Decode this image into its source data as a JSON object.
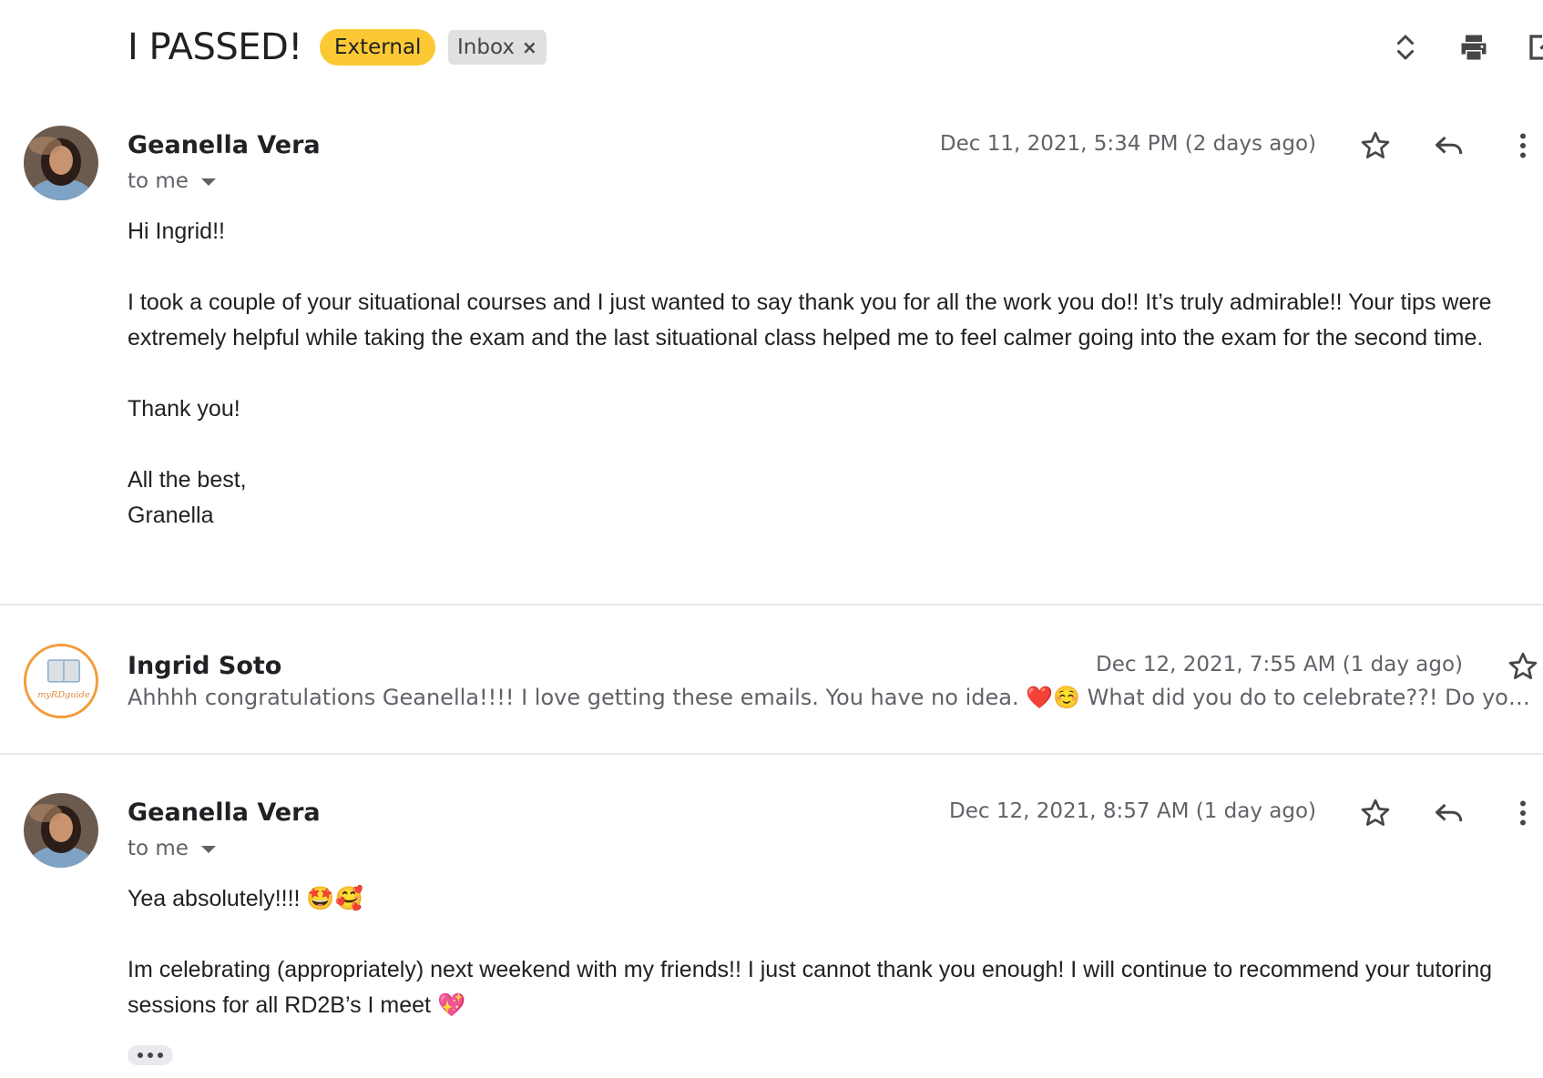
{
  "thread": {
    "subject": "I PASSED!",
    "labels": {
      "external": "External",
      "inbox": "Inbox",
      "inbox_remove": "×"
    },
    "colors": {
      "external_label_bg": "#fcc934",
      "inbox_label_bg": "#e0e0e0"
    },
    "toolbar_icons": [
      "expand-collapse-icon",
      "print-icon",
      "open-in-new-window-icon"
    ]
  },
  "messages": [
    {
      "sender": "Geanella Vera",
      "recipient": "to me",
      "date": "Dec 11, 2021, 5:34 PM (2 days ago)",
      "body": {
        "greeting": "Hi Ingrid!!",
        "para1": "I took a couple of your situational courses and I just wanted to say thank you for all the work you do!! It’s truly admirable!! Your tips were extremely helpful while taking the exam and the last situational class helped me to feel calmer going into the exam for the second time.",
        "thanks": "Thank you!",
        "closing": "All the best,",
        "signature": "Granella"
      },
      "icons": [
        "star-icon",
        "reply-icon",
        "more-vert-icon"
      ]
    },
    {
      "sender": "Ingrid Soto",
      "date": "Dec 12, 2021, 7:55 AM (1 day ago)",
      "snippet": "Ahhhh congratulations Geanella!!!! I love getting these emails. You have no idea. ❤️☺️ What did you do to celebrate??! Do you have any plans?",
      "avatar_text": "myRDguide",
      "icons": [
        "star-icon"
      ]
    },
    {
      "sender": "Geanella Vera",
      "recipient": "to me",
      "date": "Dec 12, 2021, 8:57 AM (1 day ago)",
      "body": {
        "line1": "Yea absolutely!!!! 🤩🥰",
        "para1": "Im celebrating (appropriately) next weekend with my friends!! I just cannot thank you enough! I will continue to recommend your tutoring sessions for all RD2B’s I meet 💖"
      },
      "icons": [
        "star-icon",
        "reply-icon",
        "more-vert-icon"
      ]
    }
  ]
}
